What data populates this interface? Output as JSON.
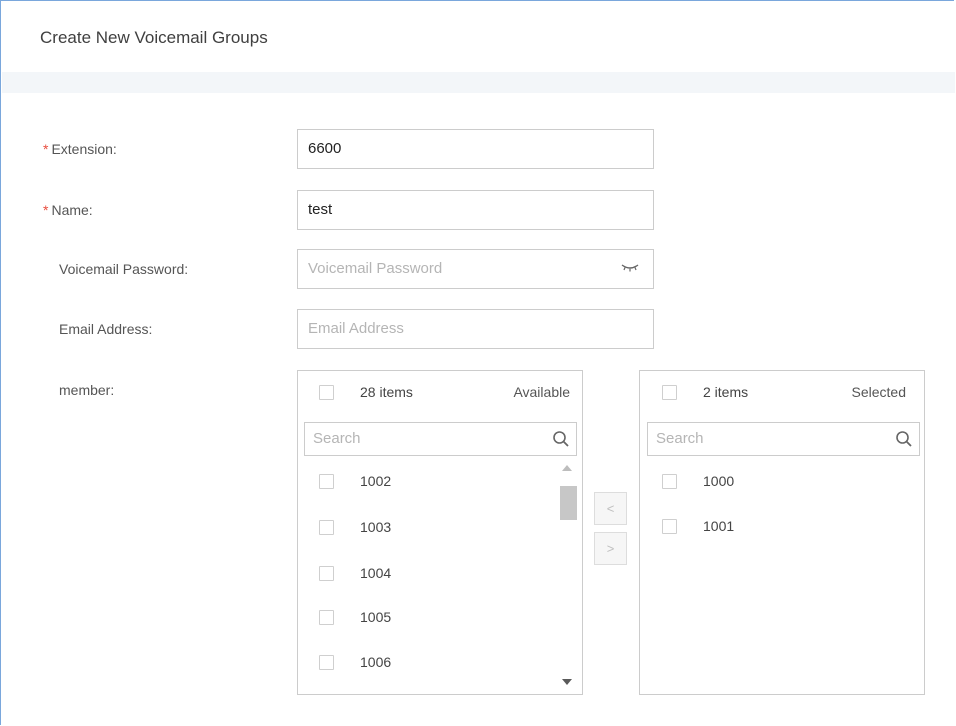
{
  "header": {
    "title": "Create New Voicemail Groups"
  },
  "form": {
    "extension": {
      "required_mark": "*",
      "label": "Extension:",
      "value": "6600"
    },
    "name": {
      "required_mark": "*",
      "label": "Name:",
      "value": "test"
    },
    "voicemail_password": {
      "label": "Voicemail Password:",
      "value": "",
      "placeholder": "Voicemail Password",
      "icon": "eye-closed-icon"
    },
    "email_address": {
      "label": "Email Address:",
      "value": "",
      "placeholder": "Email Address"
    },
    "member": {
      "label": "member:"
    }
  },
  "available": {
    "count": "28 items",
    "title": "Available",
    "search_placeholder": "Search",
    "items": [
      "1002",
      "1003",
      "1004",
      "1005",
      "1006"
    ]
  },
  "selected": {
    "count": "2 items",
    "title": "Selected",
    "search_placeholder": "Search",
    "items": [
      "1000",
      "1001"
    ]
  },
  "transfer": {
    "left_label": "<",
    "right_label": ">"
  },
  "colors": {
    "required": "#e84c3d",
    "frame_border": "#7aa7dc",
    "band": "#f3f6f9"
  }
}
